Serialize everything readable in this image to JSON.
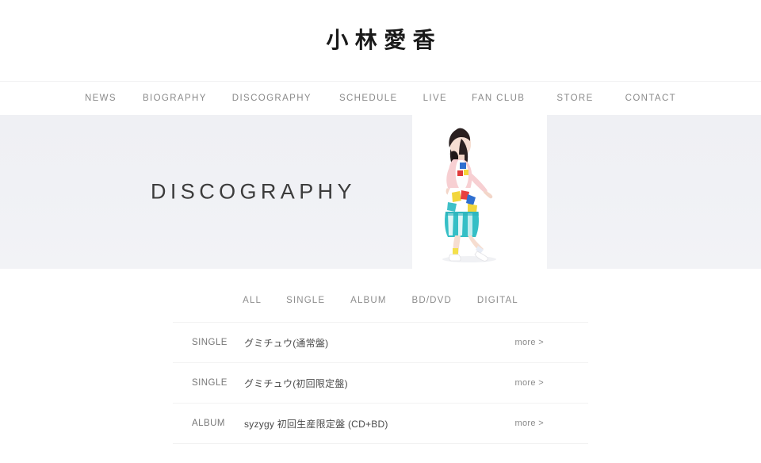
{
  "site": {
    "title": "小林愛香"
  },
  "nav": {
    "items": [
      {
        "label": "NEWS",
        "name": "nav-item-news"
      },
      {
        "label": "BIOGRAPHY",
        "name": "nav-item-biography"
      },
      {
        "label": "DISCOGRAPHY",
        "name": "nav-item-discography"
      },
      {
        "label": "SCHEDULE",
        "name": "nav-item-schedule"
      },
      {
        "label": "LIVE",
        "name": "nav-item-live"
      },
      {
        "label": "FAN CLUB",
        "name": "nav-item-fan-club"
      },
      {
        "label": "STORE",
        "name": "nav-item-store"
      },
      {
        "label": "CONTACT",
        "name": "nav-item-contact"
      }
    ]
  },
  "hero": {
    "title": "DISCOGRAPHY",
    "background_color": "#f0f1f5",
    "photo_alt": "artist-photo"
  },
  "filters": {
    "tabs": [
      {
        "label": "ALL",
        "name": "filter-tab-all"
      },
      {
        "label": "SINGLE",
        "name": "filter-tab-single"
      },
      {
        "label": "ALBUM",
        "name": "filter-tab-album"
      },
      {
        "label": "BD/DVD",
        "name": "filter-tab-bd-dvd"
      },
      {
        "label": "DIGITAL",
        "name": "filter-tab-digital"
      }
    ]
  },
  "discography": {
    "more_label": "more >",
    "rows": [
      {
        "type": "SINGLE",
        "title": "グミチュウ(通常盤)",
        "more": "more >"
      },
      {
        "type": "SINGLE",
        "title": "グミチュウ(初回限定盤)",
        "more": "more >"
      },
      {
        "type": "ALBUM",
        "title": "syzygy 初回生産限定盤 (CD+BD)",
        "more": "more >"
      }
    ]
  },
  "colors": {
    "text_primary": "#333333",
    "text_muted": "#8a8a8a",
    "hero_bg": "#f0f1f5",
    "divider": "#f2f2f2",
    "page_bg": "#ffffff"
  }
}
